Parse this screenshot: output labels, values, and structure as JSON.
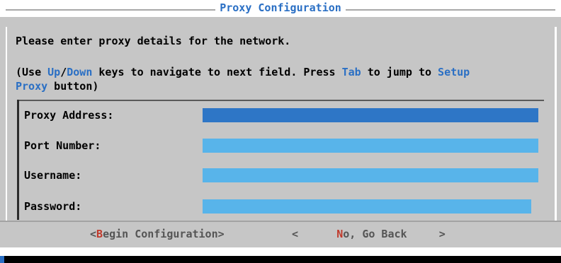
{
  "dialog": {
    "title": "Proxy Configuration",
    "intro": "Please enter proxy details for the network.",
    "help": {
      "p1": "(Use ",
      "up": "Up",
      "slash": "/",
      "down": "Down",
      "p2": " keys to navigate to next field. Press ",
      "tab": "Tab",
      "p3": " to jump to ",
      "setup": "Setup",
      "proxy": "Proxy",
      "p4": " button)"
    }
  },
  "fields": [
    {
      "label": "Proxy Address:",
      "value": "",
      "active": true
    },
    {
      "label": "Port Number:",
      "value": "",
      "active": false
    },
    {
      "label": "Username:",
      "value": "",
      "active": false
    },
    {
      "label": "Password:",
      "value": "",
      "active": false
    }
  ],
  "buttons": {
    "begin": {
      "open": "<",
      "hotkey": "B",
      "rest": "egin Configuration",
      "close": ">"
    },
    "back": {
      "open": "<",
      "hotkey": "N",
      "rest": "o, Go Back",
      "close": ">"
    }
  },
  "colors": {
    "background": "#c6c6c6",
    "accent": "#2a6fc4",
    "field": "#58b4ea",
    "field_active": "#2e76c6",
    "hotkey": "#c0392b"
  }
}
